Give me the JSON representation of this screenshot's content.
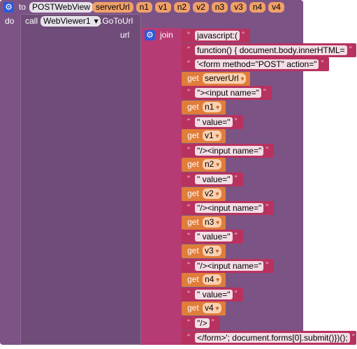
{
  "procedure": {
    "to_label": "to",
    "name": "POSTWebView",
    "params": [
      "serverUrl",
      "n1",
      "v1",
      "n2",
      "v2",
      "n3",
      "v3",
      "n4",
      "v4"
    ],
    "do_label": "do"
  },
  "call": {
    "call_label": "call",
    "component": "WebViewer1",
    "component_caret": "▾",
    "method": ".GoToUrl",
    "url_label": "url"
  },
  "join": {
    "label": "join"
  },
  "rows": [
    {
      "kind": "text",
      "value": "javascript:("
    },
    {
      "kind": "text",
      "value": "function() {  document.body.innerHTML="
    },
    {
      "kind": "text",
      "value": "'<form method=\"POST\"  action=\""
    },
    {
      "kind": "get",
      "label": "get",
      "value": "serverUrl"
    },
    {
      "kind": "text",
      "value": "\"><input name=\""
    },
    {
      "kind": "get",
      "label": "get",
      "value": "n1"
    },
    {
      "kind": "text",
      "value": "\" value=\""
    },
    {
      "kind": "get",
      "label": "get",
      "value": "v1"
    },
    {
      "kind": "text",
      "value": "\"/><input name=\""
    },
    {
      "kind": "get",
      "label": "get",
      "value": "n2"
    },
    {
      "kind": "text",
      "value": "\" value=\""
    },
    {
      "kind": "get",
      "label": "get",
      "value": "v2"
    },
    {
      "kind": "text",
      "value": "\"/><input name=\""
    },
    {
      "kind": "get",
      "label": "get",
      "value": "n3"
    },
    {
      "kind": "text",
      "value": "\" value=\""
    },
    {
      "kind": "get",
      "label": "get",
      "value": "v3"
    },
    {
      "kind": "text",
      "value": "\"/><input name=\""
    },
    {
      "kind": "get",
      "label": "get",
      "value": "n4"
    },
    {
      "kind": "text",
      "value": "\" value=\""
    },
    {
      "kind": "get",
      "label": "get",
      "value": "v4"
    },
    {
      "kind": "text",
      "value": "\"/>"
    },
    {
      "kind": "text",
      "value": "</form>'; document.forms[0].submit()})();"
    }
  ],
  "colors": {
    "procedure": "#7c5385",
    "join": "#b63a73",
    "text_block": "#b8325f",
    "get_block": "#e07d3a",
    "gear": "#2f5ad8"
  },
  "icons": {
    "mutator": "gear-icon"
  }
}
